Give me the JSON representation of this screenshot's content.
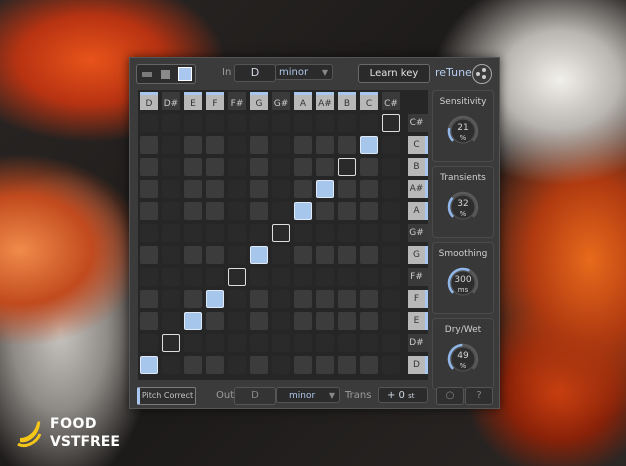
{
  "header": {
    "in_label": "In",
    "key": "D",
    "mode": "minor",
    "learn_key": "Learn key",
    "logo": "reTune"
  },
  "columns": [
    "D",
    "D#",
    "E",
    "F",
    "F#",
    "G",
    "G#",
    "A",
    "A#",
    "B",
    "C",
    "C#"
  ],
  "column_active": [
    true,
    false,
    true,
    true,
    false,
    true,
    false,
    true,
    true,
    true,
    true,
    false
  ],
  "rows": [
    "C#",
    "C",
    "B",
    "A#",
    "A",
    "G#",
    "G",
    "F#",
    "F",
    "E",
    "D#",
    "D"
  ],
  "row_active": [
    false,
    true,
    true,
    true,
    true,
    false,
    true,
    false,
    true,
    true,
    false,
    true
  ],
  "grid_marks": [
    {
      "row": "C#",
      "col": "C#",
      "state": "ring"
    },
    {
      "row": "C",
      "col": "C",
      "state": "on"
    },
    {
      "row": "B",
      "col": "B",
      "state": "ring"
    },
    {
      "row": "A#",
      "col": "A#",
      "state": "on"
    },
    {
      "row": "A",
      "col": "A",
      "state": "on"
    },
    {
      "row": "G#",
      "col": "G#",
      "state": "ring"
    },
    {
      "row": "G",
      "col": "G",
      "state": "on"
    },
    {
      "row": "F#",
      "col": "F#",
      "state": "ring"
    },
    {
      "row": "F",
      "col": "F",
      "state": "on"
    },
    {
      "row": "E",
      "col": "E",
      "state": "on"
    },
    {
      "row": "D#",
      "col": "D#",
      "state": "ring"
    },
    {
      "row": "D",
      "col": "D",
      "state": "on"
    }
  ],
  "knobs": [
    {
      "title": "Sensitivity",
      "value": "21",
      "unit": "%",
      "level": 0.21
    },
    {
      "title": "Transients",
      "value": "32",
      "unit": "%",
      "level": 0.32
    },
    {
      "title": "Smoothing",
      "value": "300",
      "unit": "ms",
      "level": 0.6
    },
    {
      "title": "Dry/Wet",
      "value": "49",
      "unit": "%",
      "level": 0.49
    }
  ],
  "footer": {
    "pitch_correct": "Pitch Correct",
    "out_label": "Out",
    "out_key": "D",
    "out_mode": "minor",
    "trans_label": "Trans",
    "trans_value": "+ 0",
    "trans_unit": "st",
    "help": "?"
  },
  "brand": {
    "line1": "FOOD",
    "line2": "VSTFREE"
  },
  "colors": {
    "accent": "#a6c6ec",
    "panel": "#3b3b3b"
  }
}
